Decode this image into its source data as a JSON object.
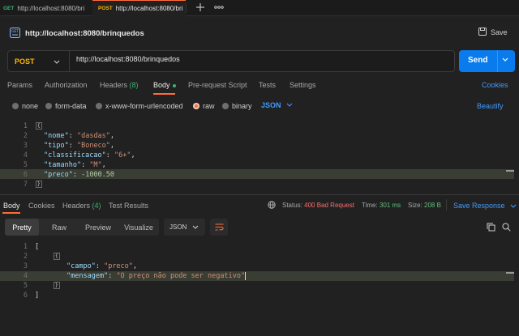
{
  "tabs": [
    {
      "method": "GET",
      "label": "http://localhost:8080/bri",
      "method_color": "#3cb371"
    },
    {
      "method": "POST",
      "label": "http://localhost:8080/bri",
      "method_color": "#ffb400"
    }
  ],
  "request": {
    "title": "http://localhost:8080/brinquedos",
    "save_label": "Save",
    "method": "POST",
    "url": "http://localhost:8080/brinquedos",
    "send_label": "Send"
  },
  "request_tabs": {
    "params": "Params",
    "authorization": "Authorization",
    "headers": "Headers",
    "headers_count": "(8)",
    "body": "Body",
    "prerequest": "Pre-request Script",
    "tests": "Tests",
    "settings": "Settings",
    "cookies": "Cookies"
  },
  "body_types": {
    "none": "none",
    "form_data": "form-data",
    "urlencoded": "x-www-form-urlencoded",
    "raw": "raw",
    "binary": "binary",
    "format": "JSON",
    "beautify": "Beautify"
  },
  "request_body": {
    "line_numbers": [
      "1",
      "2",
      "3",
      "4",
      "5",
      "6",
      "7"
    ],
    "open": "{",
    "close": "}",
    "fields": [
      {
        "key": "\"nome\"",
        "value": "\"dasdas\"",
        "type": "string",
        "comma": ","
      },
      {
        "key": "\"tipo\"",
        "value": "\"Boneco\"",
        "type": "string",
        "comma": ","
      },
      {
        "key": "\"classificacao\"",
        "value": "\"6+\"",
        "type": "string",
        "comma": ","
      },
      {
        "key": "\"tamanho\"",
        "value": "\"M\"",
        "type": "string",
        "comma": ","
      },
      {
        "key": "\"preco\"",
        "value": "-1000.50",
        "type": "number",
        "comma": ""
      }
    ]
  },
  "response_tabs": {
    "body": "Body",
    "cookies": "Cookies",
    "headers": "Headers",
    "headers_count": "(4)",
    "test_results": "Test Results"
  },
  "response_meta": {
    "status_label": "Status:",
    "status_value": "400 Bad Request",
    "time_label": "Time:",
    "time_value": "301 ms",
    "size_label": "Size:",
    "size_value": "208 B",
    "save_response": "Save Response"
  },
  "response_view": {
    "pretty": "Pretty",
    "raw": "Raw",
    "preview": "Preview",
    "visualize": "Visualize",
    "format": "JSON"
  },
  "response_body": {
    "line_numbers": [
      "1",
      "2",
      "3",
      "4",
      "5",
      "6"
    ],
    "open": "[",
    "obj_open": "{",
    "obj_close": "}",
    "close": "]",
    "fields": [
      {
        "key": "\"campo\"",
        "value": "\"preco\"",
        "comma": ","
      },
      {
        "key": "\"mensagem\"",
        "value": "\"O preço não pode ser negativo\"",
        "comma": ""
      }
    ]
  },
  "colors": {
    "accent": "#ff6c37",
    "send": "#097bed",
    "link": "#3e9bff",
    "post": "#ffb400",
    "get": "#3cb371",
    "error": "#ff6b6b"
  }
}
